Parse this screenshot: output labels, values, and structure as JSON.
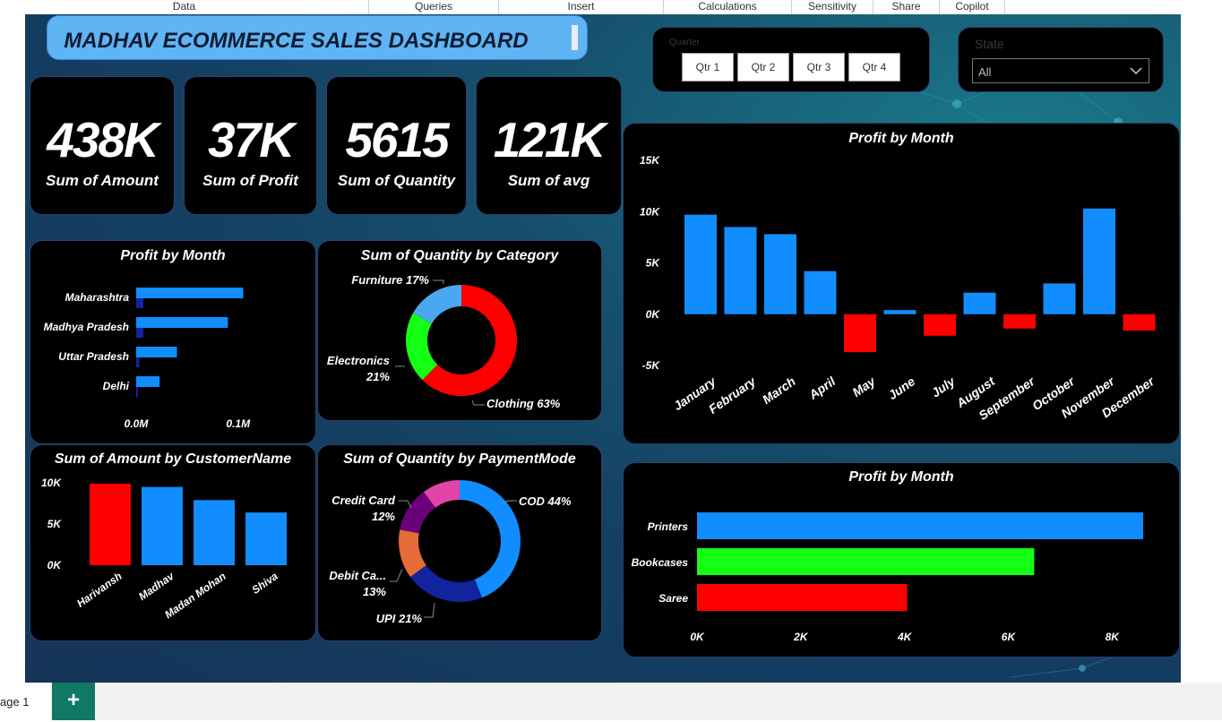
{
  "ribbon": {
    "items": [
      "Data",
      "Queries",
      "Insert",
      "Calculations",
      "Sensitivity",
      "Share",
      "Copilot"
    ]
  },
  "dashboard": {
    "title": "MADHAV ECOMMERCE SALES DASHBOARD"
  },
  "kpis": [
    {
      "value": "438K",
      "label": "Sum of Amount"
    },
    {
      "value": "37K",
      "label": "Sum of Profit"
    },
    {
      "value": "5615",
      "label": "Sum of Quantity"
    },
    {
      "value": "121K",
      "label": "Sum of avg"
    }
  ],
  "quarter_slicer": {
    "label": "Quarter",
    "options": [
      "Qtr 1",
      "Qtr 2",
      "Qtr 3",
      "Qtr 4"
    ]
  },
  "state_slicer": {
    "label": "State",
    "selected": "All"
  },
  "footer": {
    "page_tab": "age 1",
    "add_label": "+"
  },
  "colors": {
    "blue": "#118dff",
    "dark_blue": "#12239e",
    "red": "#ff0000",
    "green": "#13ff13",
    "light_blue": "#4aa8f0",
    "orange": "#e66c37",
    "purple": "#6b007b",
    "pink": "#e044a7"
  },
  "chart_data": [
    {
      "id": "state-bar",
      "type": "bar",
      "orientation": "horizontal",
      "title": "Profit by Month",
      "categories": [
        "Maharashtra",
        "Madhya Pradesh",
        "Uttar Pradesh",
        "Delhi"
      ],
      "series": [
        {
          "values": [
            105000,
            90000,
            40000,
            23000
          ]
        },
        {
          "values": [
            7000,
            7000,
            3000,
            1000
          ]
        }
      ],
      "xlim": [
        0,
        160000
      ],
      "xticks": [
        "0.0M",
        "0.1M"
      ],
      "grid": false
    },
    {
      "id": "category-donut",
      "type": "pie",
      "donut": true,
      "title": "Sum of Quantity by Category",
      "slices": [
        {
          "label": "Clothing",
          "value": 63,
          "text": "Clothing 63%"
        },
        {
          "label": "Electronics",
          "value": 21,
          "text": "Electronics 21%"
        },
        {
          "label": "Furniture",
          "value": 17,
          "text": "Furniture 17%"
        }
      ]
    },
    {
      "id": "month-column",
      "type": "bar",
      "title": "Profit by Month",
      "categories": [
        "January",
        "February",
        "March",
        "April",
        "May",
        "June",
        "July",
        "August",
        "September",
        "October",
        "November",
        "December"
      ],
      "values": [
        9700,
        8500,
        7800,
        4200,
        -3700,
        400,
        -2100,
        2100,
        -1400,
        3000,
        10300,
        -1600
      ],
      "ylim": [
        -5000,
        15000
      ],
      "yticks": [
        "15K",
        "10K",
        "5K",
        "0K",
        "-5K"
      ],
      "grid": false
    },
    {
      "id": "customer-column",
      "type": "bar",
      "title": "Sum of Amount by CustomerName",
      "categories": [
        "Harivansh",
        "Madhav",
        "Madan Mohan",
        "Shiva"
      ],
      "values": [
        9900,
        9500,
        7900,
        6400
      ],
      "ylim": [
        0,
        10000
      ],
      "yticks": [
        "10K",
        "5K",
        "0K"
      ],
      "grid": false
    },
    {
      "id": "payment-donut",
      "type": "pie",
      "donut": true,
      "title": "Sum of Quantity by PaymentMode",
      "slices": [
        {
          "label": "COD",
          "value": 44,
          "text": "COD 44%"
        },
        {
          "label": "UPI",
          "value": 21,
          "text": "UPI 21%"
        },
        {
          "label": "Debit Ca...",
          "value": 13,
          "text": "Debit Ca... 13%"
        },
        {
          "label": "Credit Card",
          "value": 12,
          "text": "Credit Card 12%"
        },
        {
          "label": "",
          "value": 10,
          "text": ""
        }
      ]
    },
    {
      "id": "subcategory-bar",
      "type": "bar",
      "orientation": "horizontal",
      "title": "Profit by Month",
      "categories": [
        "Printers",
        "Bookcases",
        "Saree"
      ],
      "values": [
        8600,
        6500,
        4050
      ],
      "xlim": [
        0,
        8600
      ],
      "xticks": [
        "0K",
        "2K",
        "4K",
        "6K",
        "8K"
      ],
      "grid": false
    }
  ]
}
